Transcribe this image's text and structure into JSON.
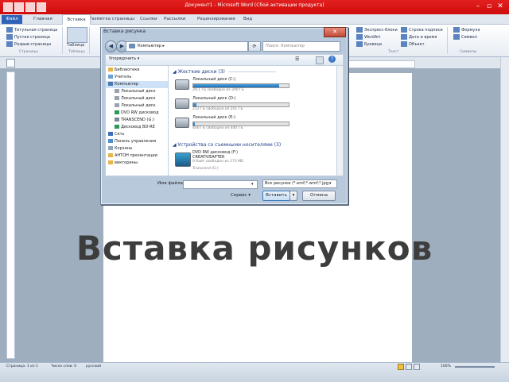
{
  "app": {
    "title": "Документ1 - Microsoft Word (Сбой активации продукта)",
    "window_buttons": [
      "–",
      "▫",
      "✕"
    ],
    "tabs": [
      "Файл",
      "Главная",
      "Вставка",
      "Разметка страницы",
      "Ссылки",
      "Рассылки",
      "Рецензирование",
      "Вид"
    ],
    "active_tab": "Вставка"
  },
  "ribbon": {
    "left_items": [
      "Титульная страница",
      "Пустая страница",
      "Разрыв страницы"
    ],
    "left_group": "Страницы",
    "table_label": "Таблица",
    "tables_group": "Таблицы",
    "right_col1": [
      "Экспресс-блоки",
      "WordArt",
      "Буквица"
    ],
    "right_col2": [
      "Строка подписи",
      "Дата и время",
      "Объект"
    ],
    "right_col3": [
      "Формула",
      "Символ"
    ],
    "group_text": "Текст",
    "group_symbols": "Символы"
  },
  "dialog": {
    "title": "Вставка рисунка",
    "close": "✕",
    "address": "Компьютер",
    "search_placeholder": "Поиск: Компьютер",
    "toolbar_organize": "Упорядочить",
    "nav_items": [
      "Библиотеки",
      "Учитель",
      "Компьютер",
      "Локальный диск",
      "Локальный диск",
      "Локальный диск",
      "DVD RW дисковод",
      "TRANSCEND (G:)",
      "Дисковод BD-RE",
      "Сеть",
      "Панель управления",
      "Корзина",
      "АНТОН презентации",
      "викторины"
    ],
    "group_hdd": "Жесткие диски (3)",
    "drives": [
      {
        "name": "Локальный диск (C:)",
        "free": "20,1 ГБ свободно из 200 ГБ",
        "used_fraction": 0.9
      },
      {
        "name": "Локальный диск (D:)",
        "free": "212 ГБ свободно из 201 ГБ",
        "used_fraction": 0.03
      },
      {
        "name": "Локальный диск (E:)",
        "free": "400 ГБ свободно из 400 ГБ",
        "used_fraction": 0.02
      }
    ],
    "group_removable": "Устройства со съемными носителями (3)",
    "removable": {
      "name": "DVD RW дисковод (F:)",
      "label": "CREATIVEAPTER",
      "free": "0 байт свободно из 173 МБ",
      "extra": "Transcend (G:)"
    },
    "filename_label": "Имя файла:",
    "filename_value": "",
    "filetype_value": "Все рисунки (*.emf;*.wmf;*.jpg;",
    "service_label": "Сервис",
    "insert_button": "Вставить",
    "cancel_button": "Отмена"
  },
  "document": {
    "overlay_title": "Вставка рисунков"
  },
  "statusbar": {
    "page": "Страница: 1 из 1",
    "words": "Число слов: 0",
    "language": "русский",
    "zoom": "100%"
  }
}
